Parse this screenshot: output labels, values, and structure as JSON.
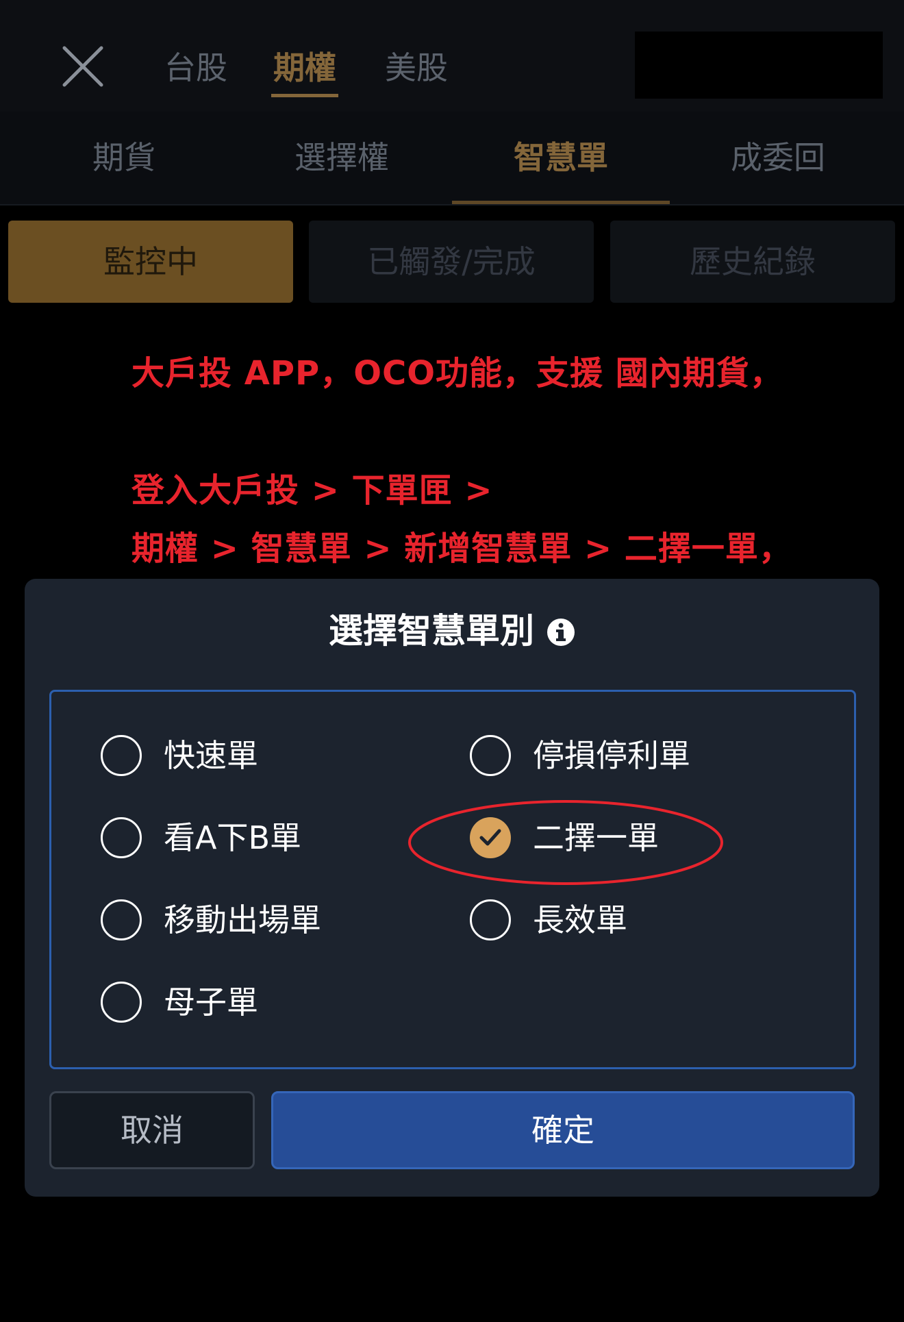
{
  "header": {
    "market_tabs": [
      {
        "label": "台股"
      },
      {
        "label": "期權"
      },
      {
        "label": "美股"
      }
    ],
    "active_market": "期權"
  },
  "product_tabs": [
    {
      "label": "期貨"
    },
    {
      "label": "選擇權"
    },
    {
      "label": "智慧單"
    },
    {
      "label": "成委回"
    }
  ],
  "active_product": "智慧單",
  "status_segments": [
    {
      "label": "監控中"
    },
    {
      "label": "已觸發/完成"
    },
    {
      "label": "歷史紀錄"
    }
  ],
  "active_segment": "監控中",
  "annotation": {
    "line1": "大戶投 APP，OCO功能，支援 國內期貨，",
    "line2": "登入大戶投 > 下單匣 >",
    "line3": "期權 > 智慧單 > 新增智慧單 > 二擇一單，",
    "color": "#e8242d"
  },
  "dialog": {
    "title": "選擇智慧單別",
    "options": [
      {
        "label": "快速單",
        "selected": false
      },
      {
        "label": "停損停利單",
        "selected": false
      },
      {
        "label": "看A下B單",
        "selected": false
      },
      {
        "label": "二擇一單",
        "selected": true
      },
      {
        "label": "移動出場單",
        "selected": false
      },
      {
        "label": "長效單",
        "selected": false
      },
      {
        "label": "母子單",
        "selected": false
      }
    ],
    "cancel_label": "取消",
    "confirm_label": "確定"
  },
  "colors": {
    "accent_gold": "#84663a",
    "selected_radio": "#d9a35c",
    "confirm_blue": "#264d97",
    "panel_border": "#2c5fae"
  },
  "icons": {
    "close": "close-icon",
    "info": "info-icon",
    "check": "check-icon"
  }
}
